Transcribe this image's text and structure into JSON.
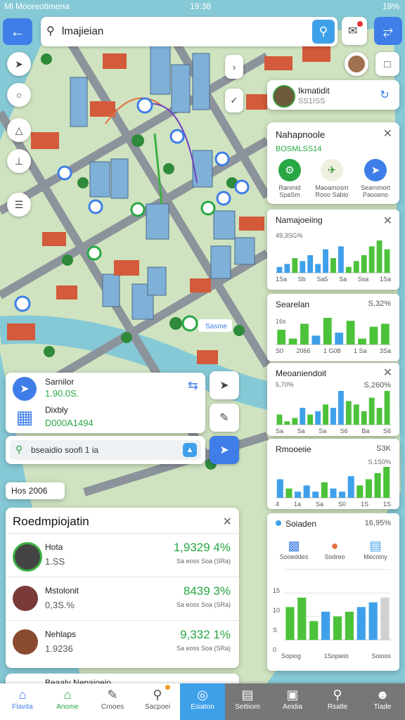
{
  "status": {
    "carrier": "Ml Mooreotimena",
    "time": "19:38",
    "battery": "19%"
  },
  "search": {
    "value": "lmajieian"
  },
  "profile": {
    "name": "Ikmatidit",
    "sub": "SS1ISS"
  },
  "nav_card": {
    "title": "Nahapnoole",
    "subtitle": "BOSMLSS14",
    "options": [
      {
        "label": "Ranmid SpaSm",
        "icon": "car-icon",
        "color": "#28a745"
      },
      {
        "label": "Maoamosm Rooo Sabio",
        "icon": "walk-icon",
        "color": "#eef0e0"
      },
      {
        "label": "Searnmort Paooeno",
        "icon": "transit-icon",
        "color": "#3f7ee8"
      }
    ]
  },
  "stat_cards": [
    {
      "title": "Namajoeiing",
      "pct": "",
      "value_label": "49,3SG%",
      "chart_data": {
        "type": "bar",
        "values": [
          2,
          3,
          5,
          4,
          6,
          3,
          8,
          5,
          9,
          2,
          4,
          6,
          9,
          11,
          8
        ],
        "colors": [
          "b",
          "b",
          "g",
          "b",
          "b",
          "b",
          "b",
          "g",
          "b",
          "g",
          "g",
          "g",
          "g",
          "g",
          "g"
        ]
      },
      "ticks": [
        "1Sa",
        "Sb",
        "Sa5",
        "Sa",
        "Ssa",
        "1Sa"
      ]
    },
    {
      "title": "Searelan",
      "pct": "S,32%",
      "value_label": "16s",
      "chart_data": {
        "type": "bar",
        "values": [
          5,
          2,
          7,
          3,
          9,
          4,
          8,
          2,
          6,
          7
        ],
        "colors": [
          "g",
          "g",
          "g",
          "b",
          "g",
          "b",
          "g",
          "g",
          "g",
          "g"
        ]
      },
      "ticks": [
        "S0",
        "2066",
        "1 G08",
        "1 Sa",
        "3Sa"
      ]
    },
    {
      "title": "Meoaniendoit",
      "pct": "S,260%",
      "value_label": "5,70%",
      "chart_data": {
        "type": "bar",
        "values": [
          3,
          1,
          2,
          5,
          3,
          4,
          6,
          5,
          10,
          7,
          6,
          4,
          8,
          5,
          10
        ],
        "colors": [
          "g",
          "g",
          "g",
          "b",
          "g",
          "b",
          "g",
          "b",
          "b",
          "g",
          "g",
          "g",
          "g",
          "g",
          "g"
        ]
      },
      "ticks": [
        "Sa",
        "Sa",
        "Sa",
        "S6",
        "Ba",
        "S6"
      ]
    },
    {
      "title": "Rmooeiie",
      "pct": "S3K",
      "value_label": "S,1S0%",
      "chart_data": {
        "type": "bar",
        "values": [
          6,
          3,
          2,
          4,
          2,
          5,
          3,
          2,
          7,
          4,
          6,
          8,
          10
        ],
        "colors": [
          "b",
          "g",
          "b",
          "b",
          "b",
          "g",
          "b",
          "b",
          "b",
          "g",
          "g",
          "g",
          "g"
        ]
      },
      "ticks": [
        "4",
        "1a",
        "Sa",
        "S0",
        "1S",
        "1S"
      ]
    },
    {
      "title": "Soiaden",
      "pct": "16,95%",
      "icons": [
        {
          "label": "Sooeddes",
          "icon": "bus-icon"
        },
        {
          "label": "Sodreo",
          "icon": "fruit-icon"
        },
        {
          "label": "Mecoiny",
          "icon": "shop-icon"
        }
      ],
      "chart_data": {
        "type": "bar",
        "values": [
          7,
          9,
          4,
          6,
          5,
          6,
          7,
          8,
          9
        ],
        "colors": [
          "g",
          "g",
          "g",
          "b",
          "g",
          "g",
          "b",
          "b",
          "gr"
        ],
        "ylim": [
          0,
          15
        ]
      },
      "yticks": [
        "15",
        "10",
        "S",
        "0"
      ],
      "ticks": [
        "Sopiog",
        "1Sopieio",
        "Soioos"
      ]
    }
  ],
  "loc_card": {
    "name": "Sarnilor",
    "name_val": "1.90.0S.",
    "sub": "Dixbly",
    "sub_val": "D000A1494"
  },
  "search2": {
    "value": "bseaidio soofi 1 ia"
  },
  "chip": {
    "label": "Hos 2006"
  },
  "list": {
    "title": "Roedmpiojatin",
    "rows": [
      {
        "name": "Hota",
        "sub": "1.SS",
        "big": "1,9329 4%",
        "small": "Sa eoss Soa (SRa)",
        "avatar_color": "#444"
      },
      {
        "name": "Mstolonit",
        "sub": "0,3S.%",
        "big": "8439 3%",
        "small": "Sa eoss Soa (SRa)",
        "avatar_color": "#7a3a3a"
      },
      {
        "name": "Nehlaps",
        "sub": "1.9236",
        "big": "9,332 1%",
        "small": "Sa eoss Soa (SRa)",
        "avatar_color": "#8a4a30"
      }
    ],
    "partial": "Beaaly Nepajoeio"
  },
  "tabs": [
    {
      "label": "Flavita",
      "icon": "home-icon",
      "style": "blue"
    },
    {
      "label": "Anome",
      "icon": "home-icon",
      "style": "grn"
    },
    {
      "label": "Crooes",
      "icon": "edit-icon",
      "style": ""
    },
    {
      "label": "Sacpoei",
      "icon": "search-icon",
      "style": "",
      "badge": true
    },
    {
      "label": "Esiaton",
      "icon": "location-icon",
      "style": "active"
    },
    {
      "label": "Seitiiom",
      "icon": "list-icon",
      "style": "dark"
    },
    {
      "label": "Aeidia",
      "icon": "bag-icon",
      "style": "dark"
    },
    {
      "label": "Rsatle",
      "icon": "search-icon",
      "style": "dark"
    },
    {
      "label": "Tiade",
      "icon": "user-icon",
      "style": "dark"
    }
  ]
}
